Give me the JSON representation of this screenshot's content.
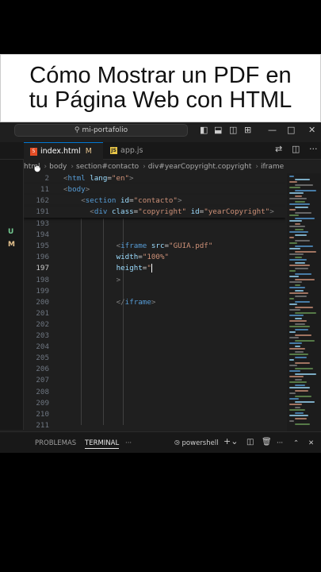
{
  "banner": {
    "line1": "Cómo Mostrar un PDF en",
    "line2": "tu Página Web con HTML"
  },
  "titlebar": {
    "search_text": "mi-portafolio",
    "icons": [
      "toggle-sidebar-icon",
      "toggle-panel-icon",
      "toggle-secondary-sidebar-icon",
      "customize-layout-icon",
      "minimize-icon",
      "maximize-icon",
      "close-icon"
    ]
  },
  "tabs": [
    {
      "label": "index.html",
      "badge": "M",
      "dirty": "●",
      "icon": "html5-icon"
    },
    {
      "label": "app.js",
      "icon": "js-icon"
    }
  ],
  "breadcrumbs": [
    "html",
    "body",
    "section#contacto",
    "div#yearCopyright.copyright",
    "iframe"
  ],
  "git_markers": [
    "U",
    "M"
  ],
  "editor": {
    "sticky": [
      {
        "ln": "2",
        "indent": 0,
        "parts": [
          [
            "pun",
            "<"
          ],
          [
            "tag",
            "html "
          ],
          [
            "attr",
            "lang"
          ],
          [
            "txt",
            "="
          ],
          [
            "str",
            "\"en\""
          ],
          [
            "pun",
            ">"
          ]
        ]
      },
      {
        "ln": "11",
        "indent": 0,
        "parts": [
          [
            "pun",
            "<"
          ],
          [
            "tag",
            "body"
          ],
          [
            "pun",
            ">"
          ]
        ]
      },
      {
        "ln": "162",
        "indent": 4,
        "parts": [
          [
            "pun",
            "<"
          ],
          [
            "tag",
            "section "
          ],
          [
            "attr",
            "id"
          ],
          [
            "txt",
            "="
          ],
          [
            "str",
            "\"contacto\""
          ],
          [
            "pun",
            ">"
          ]
        ]
      },
      {
        "ln": "191",
        "indent": 6,
        "parts": [
          [
            "pun",
            "<"
          ],
          [
            "tag",
            "div "
          ],
          [
            "attr",
            "class"
          ],
          [
            "txt",
            "="
          ],
          [
            "str",
            "\"copyright\" "
          ],
          [
            "attr",
            "id"
          ],
          [
            "txt",
            "="
          ],
          [
            "str",
            "\"yearCopyright\""
          ],
          [
            "pun",
            ">"
          ]
        ]
      }
    ],
    "lines": [
      {
        "ln": "193",
        "parts": []
      },
      {
        "ln": "194",
        "parts": []
      },
      {
        "ln": "195",
        "parts": [
          [
            "pun",
            "<"
          ],
          [
            "tag",
            "iframe "
          ],
          [
            "attr",
            "src"
          ],
          [
            "txt",
            "="
          ],
          [
            "str",
            "\"GUIA.pdf\""
          ]
        ]
      },
      {
        "ln": "196",
        "parts": [
          [
            "attr",
            "width"
          ],
          [
            "txt",
            "="
          ],
          [
            "str",
            "\"100%\""
          ]
        ]
      },
      {
        "ln": "197",
        "parts": [
          [
            "attr",
            "height"
          ],
          [
            "txt",
            "="
          ],
          [
            "str",
            "\""
          ],
          [
            "caret",
            ""
          ]
        ],
        "current": true
      },
      {
        "ln": "198",
        "parts": [
          [
            "pun",
            ">"
          ]
        ]
      },
      {
        "ln": "199",
        "parts": []
      },
      {
        "ln": "200",
        "parts": [
          [
            "pun",
            "</"
          ],
          [
            "tag",
            "iframe"
          ],
          [
            "pun",
            ">"
          ]
        ]
      },
      {
        "ln": "201",
        "parts": []
      },
      {
        "ln": "202",
        "parts": []
      },
      {
        "ln": "203",
        "parts": []
      },
      {
        "ln": "204",
        "parts": []
      },
      {
        "ln": "205",
        "parts": []
      },
      {
        "ln": "206",
        "parts": []
      },
      {
        "ln": "207",
        "parts": []
      },
      {
        "ln": "208",
        "parts": []
      },
      {
        "ln": "209",
        "parts": []
      },
      {
        "ln": "210",
        "parts": []
      },
      {
        "ln": "211",
        "parts": []
      }
    ]
  },
  "panel": {
    "tabs": [
      "PROBLEMAS",
      "TERMINAL",
      "···"
    ],
    "active": "TERMINAL",
    "shell": "powershell",
    "actions": [
      "new-terminal-icon",
      "split-terminal-icon",
      "trash-icon",
      "more-icon",
      "maximize-panel-icon",
      "close-panel-icon"
    ]
  },
  "colors": {
    "tag": "#569cd6",
    "attr": "#9cdcfe",
    "string": "#ce9178",
    "accent": "#0078d4"
  }
}
